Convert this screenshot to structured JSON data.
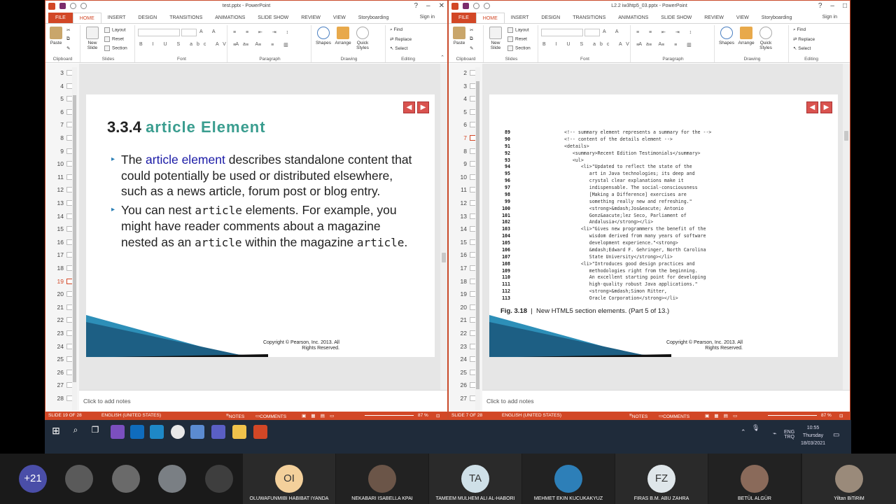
{
  "ribbon_tabs": [
    "FILE",
    "HOME",
    "INSERT",
    "DESIGN",
    "TRANSITIONS",
    "ANIMATIONS",
    "SLIDE SHOW",
    "REVIEW",
    "VIEW",
    "Storyboarding"
  ],
  "sign_in": "Sign in",
  "ribbon": {
    "paste": "Paste",
    "new_slide": "New Slide",
    "layout": "Layout",
    "reset": "Reset",
    "section": "Section",
    "shapes": "Shapes",
    "arrange": "Arrange",
    "quick_styles": "Quick Styles",
    "find": "Find",
    "replace": "Replace",
    "select": "Select",
    "groups": {
      "clipboard": "Clipboard",
      "slides": "Slides",
      "font": "Font",
      "paragraph": "Paragraph",
      "drawing": "Drawing",
      "editing": "Editing"
    }
  },
  "notes_placeholder": "Click to add notes",
  "status_notes": "NOTES",
  "status_comments": "COMMENTS",
  "status_lang": "ENGLISH (UNITED STATES)",
  "left_window": {
    "title": "test.pptx - PowerPoint",
    "thumb_numbers": [
      "3",
      "4",
      "5",
      "6",
      "7",
      "8",
      "9",
      "10",
      "11",
      "12",
      "13",
      "14",
      "15",
      "16",
      "17",
      "18",
      "19",
      "20",
      "21",
      "22",
      "23",
      "24",
      "25",
      "26",
      "27",
      "28"
    ],
    "current_slide": "19",
    "slide": {
      "heading_num": "3.3.4",
      "heading_text": "article Element",
      "b1_pre": "The ",
      "b1_link": "article element",
      "b1_post": " describes standalone content that could potentially be used or distributed elsewhere, such as a news article, forum post or blog entry.",
      "b2_a": "You can nest ",
      "b2_code1": "article",
      "b2_b": " elements. For example, you might have reader comments about a magazine nested as an ",
      "b2_code2": "article",
      "b2_c": " within the magazine ",
      "b2_code3": "article",
      "b2_d": ".",
      "copyright1": "Copyright © Pearson, Inc. 2013. All",
      "copyright2": "Rights Reserved."
    },
    "status_slide": "SLIDE 19 OF 28",
    "zoom": "87 %"
  },
  "right_window": {
    "title": "L2.2 iw3htp5_03.pptx - PowerPoint",
    "thumb_numbers": [
      "2",
      "3",
      "4",
      "5",
      "6",
      "7",
      "8",
      "9",
      "10",
      "11",
      "12",
      "13",
      "14",
      "15",
      "16",
      "17",
      "18",
      "19",
      "20",
      "21",
      "22",
      "23",
      "24",
      "25",
      "26",
      "27"
    ],
    "current_slide": "7",
    "slide": {
      "code_lines": [
        [
          "89",
          "<!-- summary element represents a summary for the -->"
        ],
        [
          "90",
          "<!-- content of the details element -->"
        ],
        [
          "91",
          "<details>"
        ],
        [
          "92",
          "   <summary>Recent Edition Testimonials</summary>"
        ],
        [
          "93",
          "   <ul>"
        ],
        [
          "94",
          "      <li>\"Updated to reflect the state of the"
        ],
        [
          "95",
          "         art in Java technologies; its deep and"
        ],
        [
          "96",
          "         crystal clear explanations make it"
        ],
        [
          "97",
          "         indispensable. The social-consciousness"
        ],
        [
          "98",
          "         [Making a Difference] exercises are"
        ],
        [
          "99",
          "         something really new and refreshing.\""
        ],
        [
          "100",
          "         <strong>&mdash;Jos&eacute; Antonio"
        ],
        [
          "101",
          "         Gonz&aacute;lez Seco, Parliament of"
        ],
        [
          "102",
          "         Andalusia</strong></li>"
        ],
        [
          "103",
          "      <li>\"Gives new programmers the benefit of the"
        ],
        [
          "104",
          "         wisdom derived from many years of software"
        ],
        [
          "105",
          "         development experience.\"<strong>"
        ],
        [
          "106",
          "         &mdash;Edward F. Gehringer, North Carolina"
        ],
        [
          "107",
          "         State University</strong></li>"
        ],
        [
          "108",
          "      <li>\"Introduces good design practices and"
        ],
        [
          "109",
          "         methodologies right from the beginning."
        ],
        [
          "110",
          "         An excellent starting point for developing"
        ],
        [
          "111",
          "         high-quality robust Java applications.\""
        ],
        [
          "112",
          "         <strong>&mdash;Simon Ritter,"
        ],
        [
          "113",
          "         Oracle Corporation</strong></li>"
        ]
      ],
      "caption_fig": "Fig. 3.18",
      "caption_text": "New HTML5 section elements. (Part 5 of 13.)",
      "copyright1": "Copyright © Pearson, Inc. 2013. All",
      "copyright2": "Rights Reserved."
    },
    "status_slide": "SLIDE 7 OF 28",
    "zoom": "87 %"
  },
  "taskbar": {
    "lang": "ENG",
    "lang2": "TRQ",
    "time": "10:55",
    "day": "Thursday",
    "date": "18/03/2021"
  },
  "participants": {
    "more": "+21",
    "people": [
      {
        "initials": "",
        "name": ""
      },
      {
        "initials": "",
        "name": ""
      },
      {
        "initials": "",
        "name": ""
      },
      {
        "initials": "",
        "name": ""
      },
      {
        "initials": "OI",
        "name": "OLUWAFUNMIBI HABIBAT IYANDA"
      },
      {
        "initials": "",
        "name": "NEKABARI ISABELLA KPAI"
      },
      {
        "initials": "TA",
        "name": "TAMEEM MULHEM ALI AL-HABORI"
      },
      {
        "initials": "",
        "name": "MEHMET EKIN KUCUKAKYUZ"
      },
      {
        "initials": "FZ",
        "name": "FIRAS B.M. ABU ZAHRA"
      },
      {
        "initials": "",
        "name": "BETÜL ALGÜR"
      },
      {
        "initials": "",
        "name": "Yiltan BiTiRiM"
      }
    ]
  },
  "colors": {
    "accent": "#d24726",
    "title_green": "#3a9d8f",
    "link_blue": "#1a1aa6"
  }
}
